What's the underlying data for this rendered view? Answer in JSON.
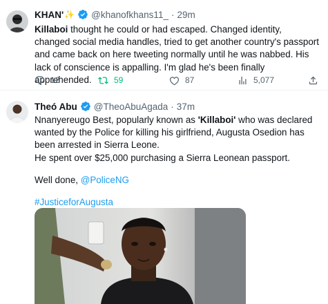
{
  "tweets": [
    {
      "name": "KHAN'",
      "name_suffix": "✨",
      "handle": "@khanofkhans11_",
      "separator": "·",
      "time": "29m",
      "text_segments": {
        "bold": "Killaboi",
        "rest": " thought he could or had escaped. Changed identity, changed social media handles, tried to get another country's passport and came back on here tweeting normally until he was nabbed. His lack of conscience is appalling. I'm glad he's been finally apprehended."
      },
      "actions": {
        "replies": "12",
        "retweets": "59",
        "likes": "87",
        "views": "5,077"
      }
    },
    {
      "name": "Theó Abu",
      "handle": "@TheoAbuAgada",
      "separator": "·",
      "time": "37m",
      "p1_before": "Nnanyereugo Best, popularly known as ",
      "p1_bold": "'Killaboi'",
      "p1_after": " who was declared wanted by the Police for killing his girlfriend, Augusta Osedion has been arrested in Sierra Leone.",
      "p2": "He spent over $25,000 purchasing a Sierra Leonean passport.",
      "p3_before": "Well done, ",
      "p3_link": "@PoliceNG",
      "hashtag": "#JusticeforAugusta"
    }
  ],
  "colors": {
    "verified": "#1d9bf0",
    "link": "#1d9bf0",
    "retweet_active": "#00ba7c",
    "secondary_text": "#536471"
  },
  "icons": [
    "verified-badge-icon",
    "reply-icon",
    "retweet-icon",
    "like-icon",
    "views-icon",
    "share-icon"
  ]
}
